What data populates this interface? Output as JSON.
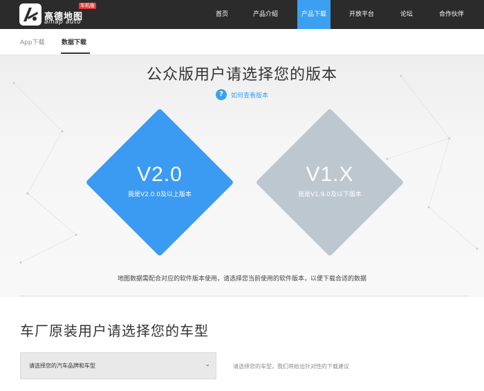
{
  "header": {
    "logo_cn": "高德地图",
    "logo_en": "amap auto",
    "logo_badge": "车机版",
    "nav": [
      {
        "label": "首页",
        "active": false
      },
      {
        "label": "产品介绍",
        "active": false
      },
      {
        "label": "产品下载",
        "active": true
      },
      {
        "label": "开放平台",
        "active": false
      },
      {
        "label": "论坛",
        "active": false
      },
      {
        "label": "合作伙伴",
        "active": false
      }
    ]
  },
  "subtabs": [
    {
      "label": "App下载",
      "active": false
    },
    {
      "label": "数据下载",
      "active": true
    }
  ],
  "hero": {
    "title": "公众版用户请选择您的版本",
    "help_icon": "?",
    "help_text": "如何查看版本",
    "versions": [
      {
        "version": "V2.0",
        "desc": "我是V2.0.0及以上版本",
        "color": "#3b9bf2"
      },
      {
        "version": "V1.X",
        "desc": "我是V1.9.0及以下版本",
        "color": "#bcc7d0"
      }
    ],
    "note": "地图数据需配合对应的软件版本使用，请选择您当前使用的软件版本，以便下载合适的数据"
  },
  "car": {
    "title": "车厂原装用户请选择您的车型",
    "select_value": "请选择您的汽车品牌和车型",
    "hint": "请选择您的车型，我们将给出针对性的下载建议"
  },
  "colors": {
    "accent": "#3ca0f0",
    "topbar": "#2b2b2b"
  }
}
